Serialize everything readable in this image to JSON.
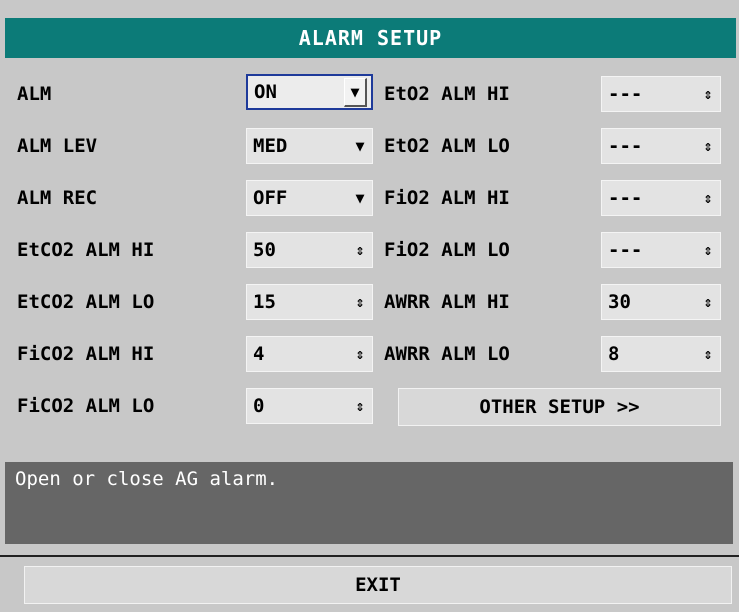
{
  "title": "ALARM SETUP",
  "left": [
    {
      "label": "ALM",
      "value": "ON",
      "type": "dropdown",
      "focused": true
    },
    {
      "label": "ALM LEV",
      "value": "MED",
      "type": "dropdown"
    },
    {
      "label": "ALM REC",
      "value": "OFF",
      "type": "dropdown"
    },
    {
      "label": "EtCO2 ALM HI",
      "value": "50",
      "type": "spinner"
    },
    {
      "label": "EtCO2 ALM LO",
      "value": "15",
      "type": "spinner"
    },
    {
      "label": "FiCO2 ALM HI",
      "value": "4",
      "type": "spinner"
    },
    {
      "label": "FiCO2 ALM LO",
      "value": "0",
      "type": "spinner"
    }
  ],
  "right": [
    {
      "label": "EtO2 ALM HI",
      "value": "---",
      "type": "spinner"
    },
    {
      "label": "EtO2 ALM LO",
      "value": "---",
      "type": "spinner"
    },
    {
      "label": "FiO2 ALM HI",
      "value": "---",
      "type": "spinner"
    },
    {
      "label": "FiO2 ALM LO",
      "value": "---",
      "type": "spinner"
    },
    {
      "label": "AWRR ALM HI",
      "value": "30",
      "type": "spinner"
    },
    {
      "label": "AWRR ALM LO",
      "value": "8",
      "type": "spinner"
    }
  ],
  "other_setup_label": "OTHER SETUP >>",
  "help_text": "Open or close AG alarm.",
  "exit_label": "EXIT",
  "icons": {
    "dropdown": "▼",
    "spinner": "⇕"
  },
  "colors": {
    "title_bg": "#0c7b78",
    "dialog_bg": "#c8c8c8",
    "help_bg": "#666666",
    "focus_border": "#1e3a9a"
  }
}
